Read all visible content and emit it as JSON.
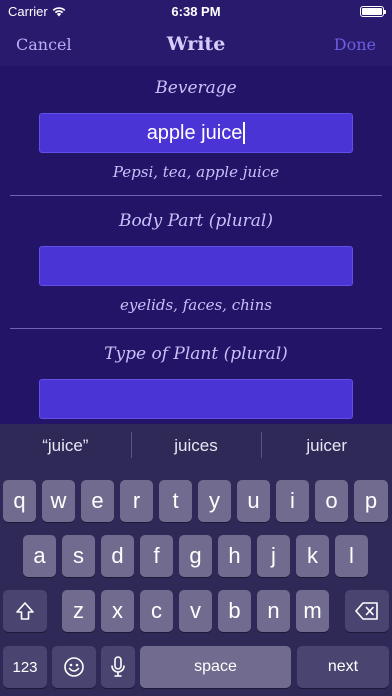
{
  "status": {
    "carrier": "Carrier",
    "time": "6:38 PM"
  },
  "nav": {
    "cancel": "Cancel",
    "title": "Write",
    "done": "Done"
  },
  "fields": [
    {
      "label": "Beverage",
      "value": "apple juice",
      "hint": "Pepsi, tea, apple juice"
    },
    {
      "label": "Body Part (plural)",
      "value": "",
      "hint": "eyelids, faces, chins"
    },
    {
      "label": "Type of Plant (plural)",
      "value": "",
      "hint": ""
    }
  ],
  "keyboard": {
    "suggestions": [
      "“juice”",
      "juices",
      "juicer"
    ],
    "row1": [
      "q",
      "w",
      "e",
      "r",
      "t",
      "y",
      "u",
      "i",
      "o",
      "p"
    ],
    "row2": [
      "a",
      "s",
      "d",
      "f",
      "g",
      "h",
      "j",
      "k",
      "l"
    ],
    "row3": [
      "z",
      "x",
      "c",
      "v",
      "b",
      "n",
      "m"
    ],
    "numbers": "123",
    "space": "space",
    "return": "next",
    "icons": {
      "shift": "shift-icon",
      "delete": "delete-icon",
      "emoji": "emoji-icon",
      "mic": "microphone-icon"
    }
  },
  "colors": {
    "background": "#231468",
    "input": "#4a34d6",
    "keyboard": "#2e2956",
    "done": "#6b5fe0"
  }
}
